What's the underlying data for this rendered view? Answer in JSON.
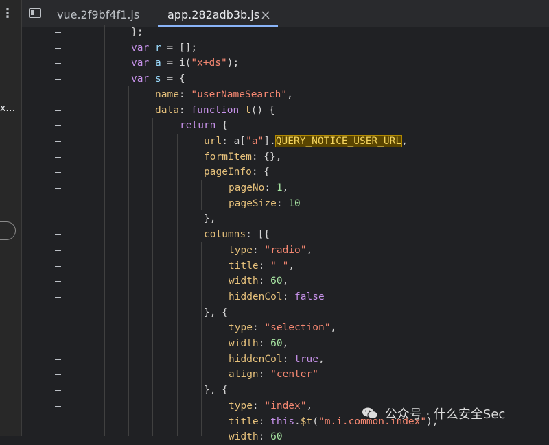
{
  "sidebar": {
    "truncated_label": "x…"
  },
  "tabs": [
    {
      "label": "vue.2f9bf4f1.js",
      "active": false
    },
    {
      "label": "app.282adb3b.js",
      "active": true
    }
  ],
  "gutter_mark": "-",
  "highlighted_identifier": "QUERY_NOTICE_USER_URL",
  "code_lines": [
    [
      [
        "p",
        "};"
      ]
    ],
    [
      [
        "k",
        "var"
      ],
      [
        "p",
        " "
      ],
      [
        "v",
        "r"
      ],
      [
        "p",
        " = [];"
      ]
    ],
    [
      [
        "k",
        "var"
      ],
      [
        "p",
        " "
      ],
      [
        "v",
        "a"
      ],
      [
        "p",
        " = i("
      ],
      [
        "s",
        "\"x+ds\""
      ],
      [
        "p",
        ");"
      ]
    ],
    [
      [
        "k",
        "var"
      ],
      [
        "p",
        " "
      ],
      [
        "v",
        "s"
      ],
      [
        "p",
        " = {"
      ]
    ],
    [
      [
        "y",
        "name"
      ],
      [
        "p",
        ": "
      ],
      [
        "s",
        "\"userNameSearch\""
      ],
      [
        "p",
        ","
      ]
    ],
    [
      [
        "y",
        "data"
      ],
      [
        "p",
        ": "
      ],
      [
        "k",
        "function"
      ],
      [
        "p",
        " "
      ],
      [
        "y",
        "t"
      ],
      [
        "p",
        "() {"
      ]
    ],
    [
      [
        "k",
        "return"
      ],
      [
        "p",
        " {"
      ]
    ],
    [
      [
        "y",
        "url"
      ],
      [
        "p",
        ": a["
      ],
      [
        "s",
        "\"a\""
      ],
      [
        "p",
        "]."
      ],
      [
        "h",
        "QUERY_NOTICE_USER_URL"
      ],
      [
        "p",
        ","
      ]
    ],
    [
      [
        "y",
        "formItem"
      ],
      [
        "p",
        ": {},"
      ]
    ],
    [
      [
        "y",
        "pageInfo"
      ],
      [
        "p",
        ": {"
      ]
    ],
    [
      [
        "y",
        "pageNo"
      ],
      [
        "p",
        ": "
      ],
      [
        "n",
        "1"
      ],
      [
        "p",
        ","
      ]
    ],
    [
      [
        "y",
        "pageSize"
      ],
      [
        "p",
        ": "
      ],
      [
        "n",
        "10"
      ]
    ],
    [
      [
        "p",
        "},"
      ]
    ],
    [
      [
        "y",
        "columns"
      ],
      [
        "p",
        ": [{"
      ]
    ],
    [
      [
        "y",
        "type"
      ],
      [
        "p",
        ": "
      ],
      [
        "s",
        "\"radio\""
      ],
      [
        "p",
        ","
      ]
    ],
    [
      [
        "y",
        "title"
      ],
      [
        "p",
        ": "
      ],
      [
        "s",
        "\" \""
      ],
      [
        "p",
        ","
      ]
    ],
    [
      [
        "y",
        "width"
      ],
      [
        "p",
        ": "
      ],
      [
        "n",
        "60"
      ],
      [
        "p",
        ","
      ]
    ],
    [
      [
        "y",
        "hiddenCol"
      ],
      [
        "p",
        ": "
      ],
      [
        "k",
        "false"
      ]
    ],
    [
      [
        "p",
        "}, {"
      ]
    ],
    [
      [
        "y",
        "type"
      ],
      [
        "p",
        ": "
      ],
      [
        "s",
        "\"selection\""
      ],
      [
        "p",
        ","
      ]
    ],
    [
      [
        "y",
        "width"
      ],
      [
        "p",
        ": "
      ],
      [
        "n",
        "60"
      ],
      [
        "p",
        ","
      ]
    ],
    [
      [
        "y",
        "hiddenCol"
      ],
      [
        "p",
        ": "
      ],
      [
        "k",
        "true"
      ],
      [
        "p",
        ","
      ]
    ],
    [
      [
        "y",
        "align"
      ],
      [
        "p",
        ": "
      ],
      [
        "s",
        "\"center\""
      ]
    ],
    [
      [
        "p",
        "}, {"
      ]
    ],
    [
      [
        "y",
        "type"
      ],
      [
        "p",
        ": "
      ],
      [
        "s",
        "\"index\""
      ],
      [
        "p",
        ","
      ]
    ],
    [
      [
        "y",
        "title"
      ],
      [
        "p",
        ": "
      ],
      [
        "k",
        "this"
      ],
      [
        "p",
        "."
      ],
      [
        "y",
        "$t"
      ],
      [
        "p",
        "("
      ],
      [
        "s",
        "\"m.i.common.index\""
      ],
      [
        "p",
        "),"
      ]
    ],
    [
      [
        "y",
        "width"
      ],
      [
        "p",
        ": "
      ],
      [
        "n",
        "60"
      ]
    ]
  ],
  "watermark": {
    "text": "公众号 · 什么安全Sec"
  },
  "colors": {
    "background": "#202124",
    "keyword": "#c792ea",
    "property": "#e5c07b",
    "string": "#f48771",
    "number": "#a6e3a1",
    "tab_accent": "#8ab4f8",
    "search_highlight": "#5a4500"
  }
}
